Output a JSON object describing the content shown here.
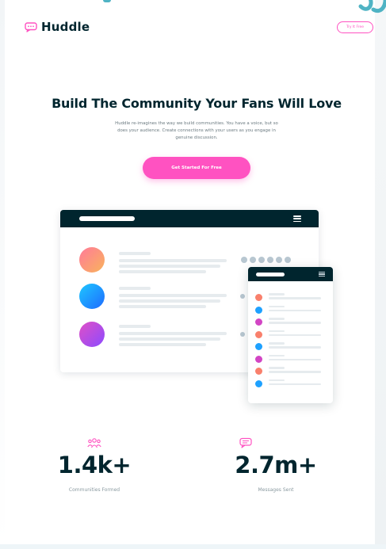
{
  "header": {
    "logo_text": "Huddle",
    "cta_label": "Try It Free"
  },
  "hero": {
    "title": "Build The Community Your Fans Will Love",
    "description": "Huddle re-imagines the way we build communities. You have a voice, but so does your audience. Create connections with your users as you engage in genuine discussion.",
    "cta_label": "Get Started For Free"
  },
  "illustration": {
    "avatar_colors": [
      "#f9a26c",
      "#1ea1ff",
      "#d245c4"
    ],
    "phone_avatar_colors": [
      "#f9806c",
      "#1ea1ff",
      "#d245c4",
      "#f9806c",
      "#1ea1ff",
      "#d245c4",
      "#f9806c",
      "#1ea1ff"
    ]
  },
  "stats": [
    {
      "value": "1.4k+",
      "label": "Communities Formed",
      "icon": "communities-icon"
    },
    {
      "value": "2.7m+",
      "label": "Messages Sent",
      "icon": "messages-icon"
    }
  ],
  "colors": {
    "accent": "#ff52c1",
    "dark": "#00252e",
    "teal": "#4fb3c4"
  }
}
